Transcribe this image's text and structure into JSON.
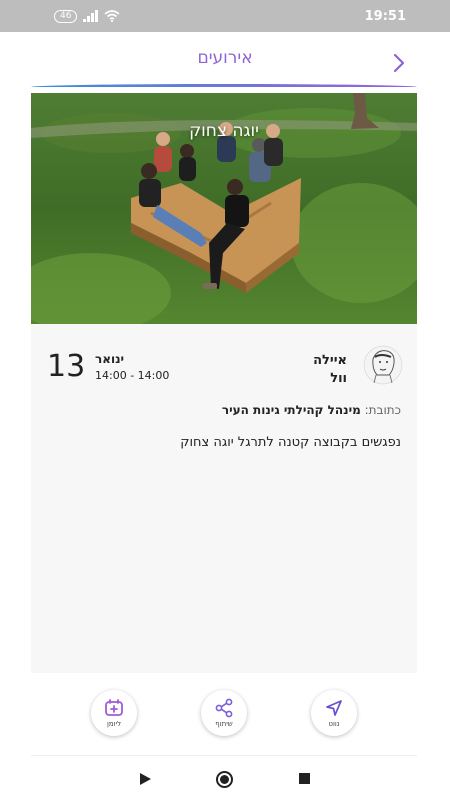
{
  "status_bar": {
    "network": "46",
    "time": "19:51"
  },
  "header": {
    "title": "אירועים"
  },
  "event": {
    "image_title": "יוגה צחוק",
    "day": "13",
    "month": "ינואר",
    "time_range": "14:00 - 14:00",
    "author_name_line1": "איילה",
    "author_name_line2": "וול",
    "address_label": "כתובת:",
    "address_value": "מינהל קהילתי גינות העיר",
    "description": "נפגשים בקבוצה קטנה לתרגל יוגה צחוק"
  },
  "actions": {
    "navigate_label": "נווט",
    "share_label": "שיתוף",
    "calendar_label": "ליומן"
  },
  "colors": {
    "accent": "#8e63d6",
    "accent_blue": "#3e8fd8",
    "calendar_icon": "#a05cd6",
    "navigate_icon": "#6a4fd0",
    "share_icon": "#7b5fd8"
  },
  "icons": [
    "chevron-right-icon",
    "navigate-arrow-icon",
    "share-icon",
    "calendar-add-icon",
    "play-triangle-icon",
    "home-circle-icon",
    "square-icon",
    "wifi-icon",
    "signal-icon"
  ]
}
